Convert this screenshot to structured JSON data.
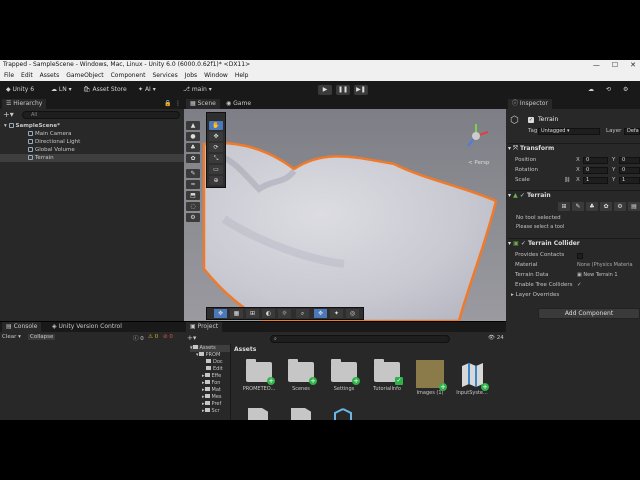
{
  "window": {
    "title": "Trapped - SampleScene - Windows, Mac, Linux - Unity 6.0 (6000.0.62f1)* <DX11>",
    "minimize": "—",
    "maximize": "☐",
    "close": "✕"
  },
  "menu": [
    "File",
    "Edit",
    "Assets",
    "GameObject",
    "Component",
    "Services",
    "Jobs",
    "Window",
    "Help"
  ],
  "toolbar": {
    "account": "Unity 6",
    "user": "LN",
    "asset_store": "Asset Store",
    "ai": "AI",
    "branch": "main"
  },
  "hierarchy": {
    "tab": "Hierarchy",
    "search_placeholder": "All",
    "scene": "SampleScene*",
    "items": [
      "Main Camera",
      "Directional Light",
      "Global Volume",
      "Terrain"
    ]
  },
  "scene_view": {
    "tab_scene": "Scene",
    "tab_game": "Game",
    "persp": "< Persp"
  },
  "inspector": {
    "tab": "Inspector",
    "object_name": "Terrain",
    "tag_label": "Tag",
    "tag_value": "Untagged",
    "layer_label": "Layer",
    "layer_value": "Defa",
    "transform": {
      "header": "Transform",
      "rows": [
        {
          "label": "Position",
          "x": "0",
          "y": "0"
        },
        {
          "label": "Rotation",
          "x": "0",
          "y": "0"
        },
        {
          "label": "Scale",
          "x": "1",
          "y": "1"
        }
      ],
      "x_label": "X",
      "y_label": "Y"
    },
    "terrain": {
      "header": "Terrain",
      "no_tool": "No tool selected",
      "select_tool": "Please select a tool"
    },
    "collider": {
      "header": "Terrain Collider",
      "rows": [
        {
          "label": "Provides Contacts",
          "value": ""
        },
        {
          "label": "Material",
          "value": "None (Physics Materia"
        },
        {
          "label": "Terrain Data",
          "value": "New Terrain 1"
        },
        {
          "label": "Enable Tree Colliders",
          "value": "✓"
        }
      ]
    },
    "layer_overrides": "Layer Overrides",
    "add_component": "Add Component"
  },
  "console": {
    "tab": "Console",
    "tab_vc": "Unity Version Control",
    "clear": "Clear",
    "collapse": "Collapse",
    "count_info": "0",
    "count_warn": "0",
    "count_err": "0"
  },
  "project": {
    "tab": "Project",
    "breadcrumb": "Assets",
    "hidden_count": "24",
    "tree": [
      "Assets",
      "PROM",
      "Doc",
      "Edit",
      "Effe",
      "Fon",
      "Mat",
      "Mes",
      "Pref",
      "Scr"
    ],
    "assets": [
      {
        "name": "PROMETEO...",
        "badge": "+"
      },
      {
        "name": "Scenes",
        "badge": "+"
      },
      {
        "name": "Settings",
        "badge": "+"
      },
      {
        "name": "TutorialInfo",
        "badge": "✓"
      },
      {
        "name": "Images (1)",
        "badge": "+"
      },
      {
        "name": "InputSyste...",
        "badge": "+"
      }
    ]
  },
  "colors": {
    "editor_bg": "#282828",
    "header_bg": "#191919",
    "selection": "#3e3e3e",
    "terrain_outline": "#f07a2a",
    "add_green": "#2fb24a"
  }
}
